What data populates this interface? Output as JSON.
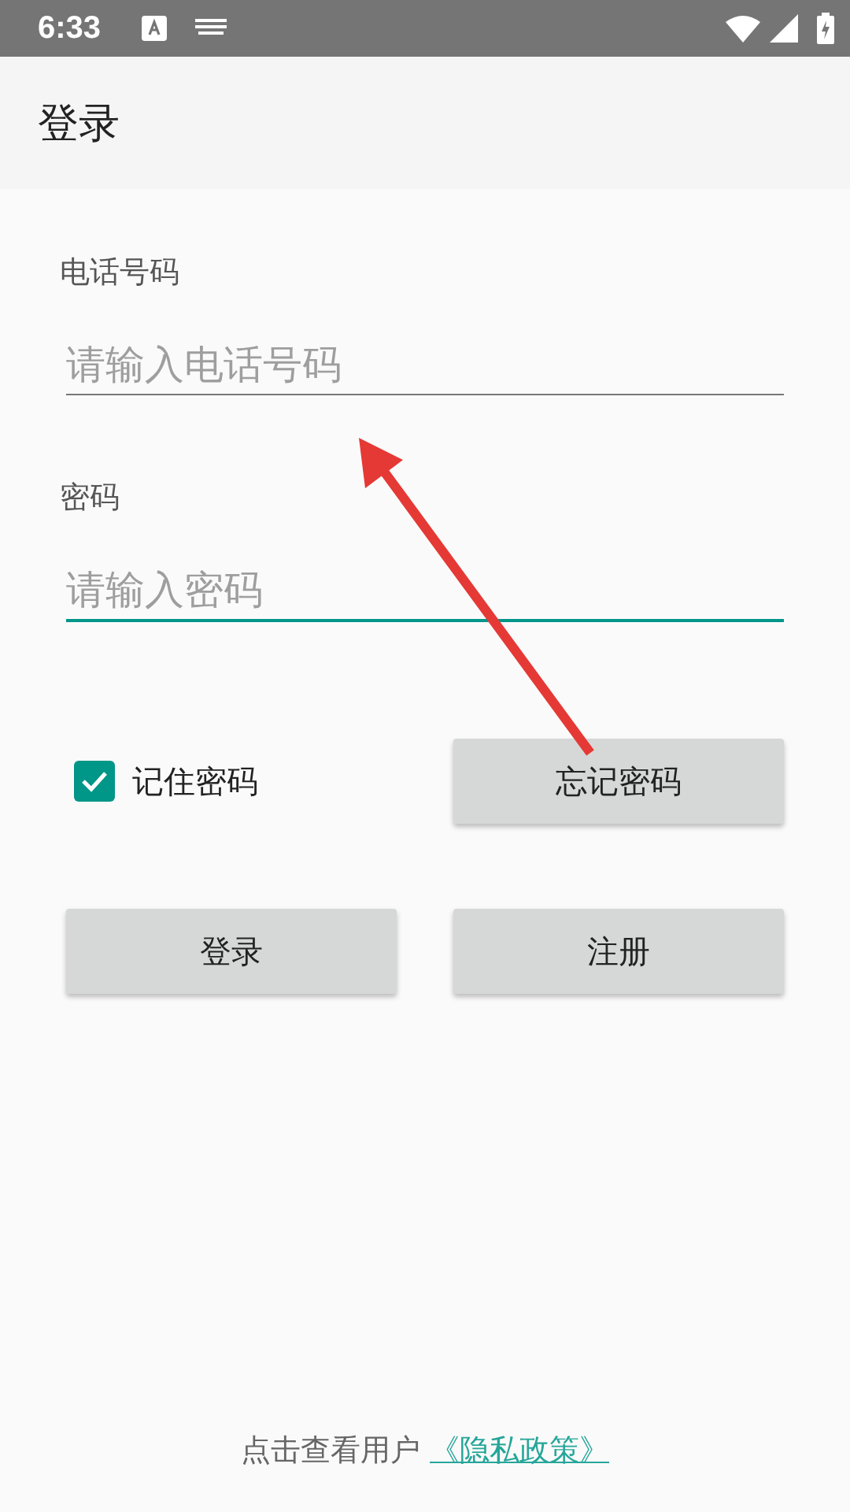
{
  "status_bar": {
    "time": "6:33"
  },
  "app_bar": {
    "title": "登录"
  },
  "fields": [
    {
      "label": "电话号码",
      "placeholder": "请输入电话号码",
      "focused": false
    },
    {
      "label": "密码",
      "placeholder": "请输入密码",
      "focused": true
    }
  ],
  "remember": {
    "label": "记住密码",
    "checked": true
  },
  "forgot_button": "忘记密码",
  "buttons": [
    "登录",
    "注册"
  ],
  "footer": {
    "text": "点击查看用户",
    "link": "《隐私政策》"
  },
  "annotation": {
    "kind": "arrow"
  }
}
